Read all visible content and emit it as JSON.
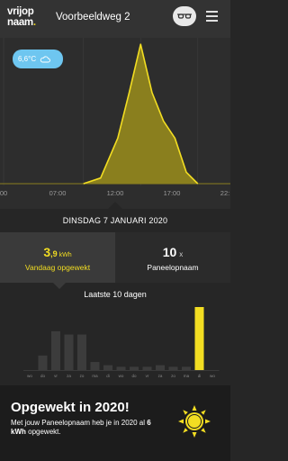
{
  "header": {
    "logo_line1": "vrijop",
    "logo_line2": "naam",
    "logo_dot": ".",
    "address": "Voorbeeldweg 2",
    "glasses_icon": "glasses-icon",
    "menu_icon": "hamburger-menu-icon"
  },
  "weather": {
    "temperature": "6,6°C",
    "icon": "cloud-icon",
    "color": "#6ec6f0"
  },
  "timeline": {
    "ticks": [
      {
        "label": "00"
      },
      {
        "label": "07:00"
      },
      {
        "label": "12:00"
      },
      {
        "label": "17:00"
      },
      {
        "label": "22:"
      }
    ]
  },
  "date_label": "DINSDAG 7 JANUARI 2020",
  "stats": {
    "today_value_big": "3",
    "today_value_small": ",9",
    "today_unit": "kWh",
    "today_label": "Vandaag opgewekt",
    "panels_value": "10",
    "panels_unit": "x",
    "panels_label": "Paneelopnaam"
  },
  "history": {
    "title": "Laatste 10 dagen",
    "day_labels": [
      "wo",
      "do",
      "vr",
      "za",
      "zo",
      "ma",
      "di",
      "wo",
      "do",
      "vr",
      "za",
      "zo",
      "ma",
      "di",
      "wo"
    ]
  },
  "banner": {
    "title": "Opgewekt in 2020!",
    "text_before": "Met jouw Paneelopnaam heb je in 2020 al ",
    "text_bold": "6 kWh",
    "text_after": " opgewekt.",
    "icon": "sun-icon"
  },
  "colors": {
    "accent": "#f2dd22",
    "area_fill": "#8a7f1e",
    "grey_bar": "#3c3c3c",
    "header_bg": "#333333"
  },
  "chart_data": [
    {
      "type": "area",
      "series": [
        {
          "values": [
            {
              "x": "07:00",
              "y": 0
            },
            {
              "x": "08:30",
              "y": 0.2
            },
            {
              "x": "10:00",
              "y": 1.6
            },
            {
              "x": "11:00",
              "y": 3.2
            },
            {
              "x": "12:00",
              "y": 4.9
            },
            {
              "x": "13:00",
              "y": 3.2
            },
            {
              "x": "14:00",
              "y": 2.2
            },
            {
              "x": "15:00",
              "y": 1.6
            },
            {
              "x": "16:00",
              "y": 0.4
            },
            {
              "x": "17:00",
              "y": 0
            }
          ]
        }
      ],
      "x_ticks": [
        "07:00",
        "12:00",
        "17:00"
      ],
      "grid": true
    },
    {
      "type": "bar",
      "categories": [
        "wo",
        "do",
        "vr",
        "za",
        "zo",
        "ma",
        "di",
        "wo",
        "do",
        "vr",
        "za",
        "zo",
        "ma",
        "di",
        "wo"
      ],
      "values": [
        0,
        0.9,
        2.4,
        2.2,
        2.2,
        0.5,
        0.3,
        0.2,
        0.2,
        0.2,
        0.3,
        0.2,
        0.2,
        3.9,
        0
      ],
      "highlight_index": 13
    }
  ]
}
